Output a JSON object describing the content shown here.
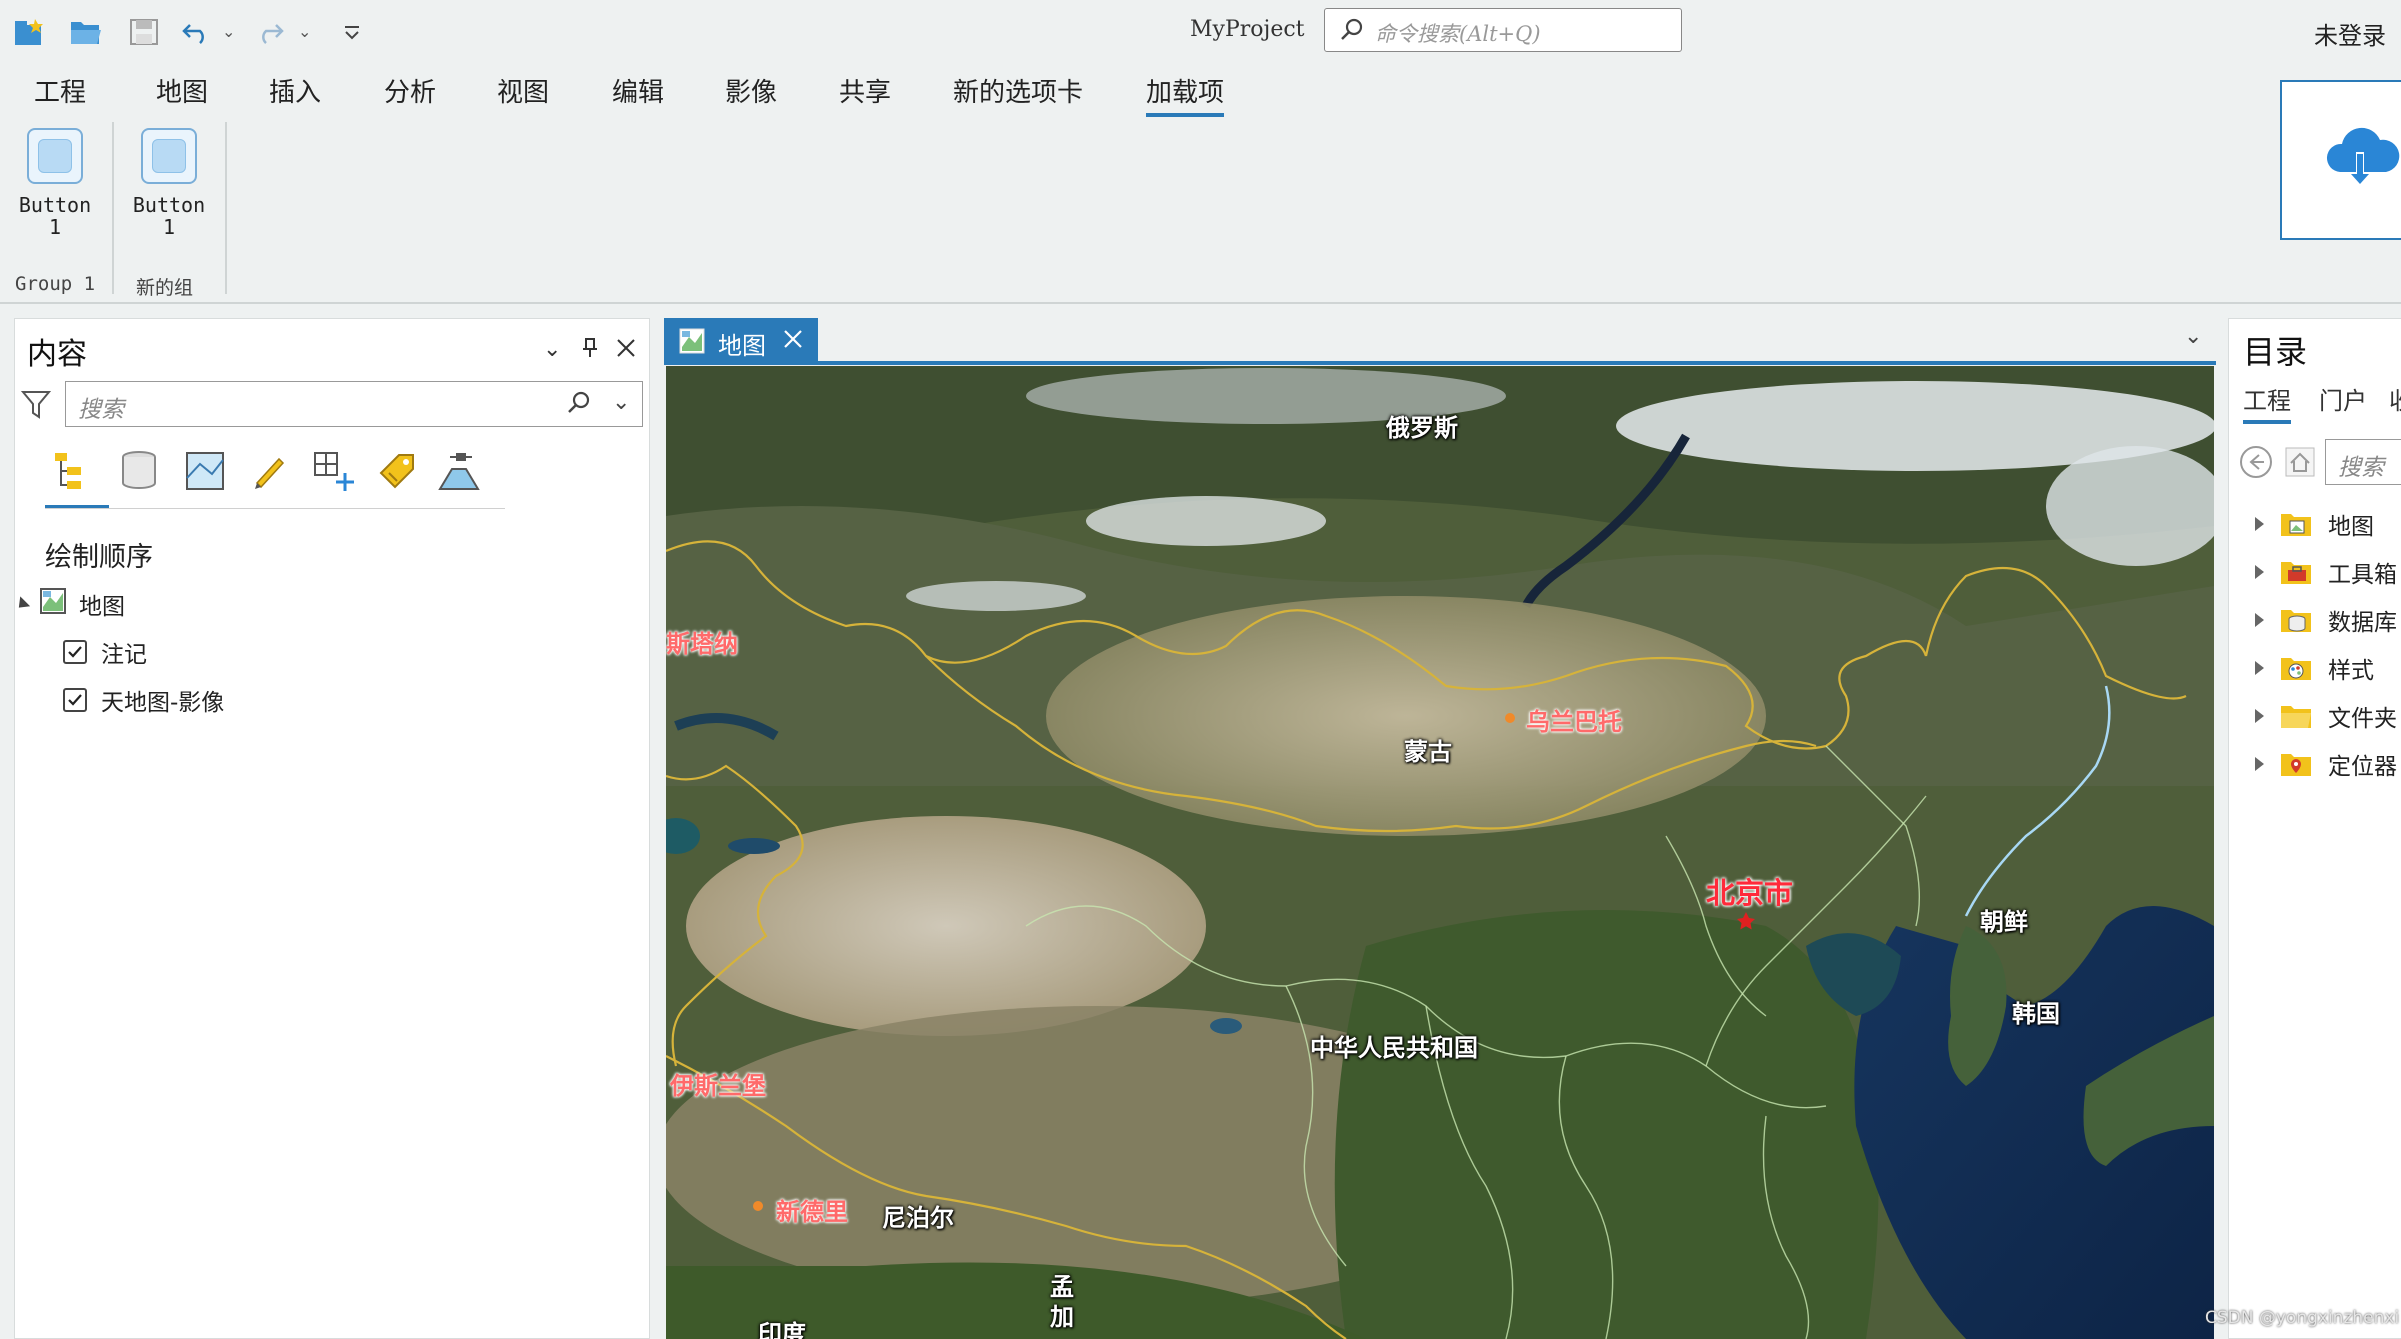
{
  "titlebar": {
    "app_title": "MyProject",
    "search_placeholder": "命令搜索(Alt+Q)",
    "user": "未登录"
  },
  "ribbon": {
    "tabs": [
      "工程",
      "地图",
      "插入",
      "分析",
      "视图",
      "编辑",
      "影像",
      "共享",
      "新的选项卡",
      "加载项"
    ],
    "active_tab": "加载项",
    "groups": [
      {
        "label": "Group 1",
        "button": [
          "Button",
          "1"
        ]
      },
      {
        "label": "新的组",
        "button": [
          "Button",
          "1"
        ]
      }
    ]
  },
  "content_pane": {
    "title": "内容",
    "search_placeholder": "搜索",
    "section": "绘制顺序",
    "tree": {
      "map": "地图",
      "layers": [
        {
          "label": "注记",
          "checked": true
        },
        {
          "label": "天地图-影像",
          "checked": true
        }
      ]
    }
  },
  "map_view": {
    "tab_label": "地图",
    "labels": {
      "russia": "俄罗斯",
      "astana": "斯塔纳",
      "mongolia": "蒙古",
      "ulaanbaatar": "乌兰巴托",
      "beijing": "北京市",
      "north_korea": "朝鲜",
      "south_korea": "韩国",
      "china": "中华人民共和国",
      "islamabad": "伊斯兰堡",
      "new_delhi": "新德里",
      "nepal": "尼泊尔",
      "bangladesh": "孟加",
      "bangladesh_top": "孟",
      "bangladesh_bottom": "加",
      "india": "印度"
    }
  },
  "catalog_pane": {
    "title": "目录",
    "tabs": [
      "工程",
      "门户",
      "收"
    ],
    "search_placeholder": "搜索",
    "items": [
      "地图",
      "工具箱",
      "数据库",
      "样式",
      "文件夹",
      "定位器"
    ]
  },
  "watermark": "CSDN @yongxinzhenxi",
  "colors": {
    "accent": "#2a7ab8",
    "capital_red": "#ff2a3a"
  }
}
